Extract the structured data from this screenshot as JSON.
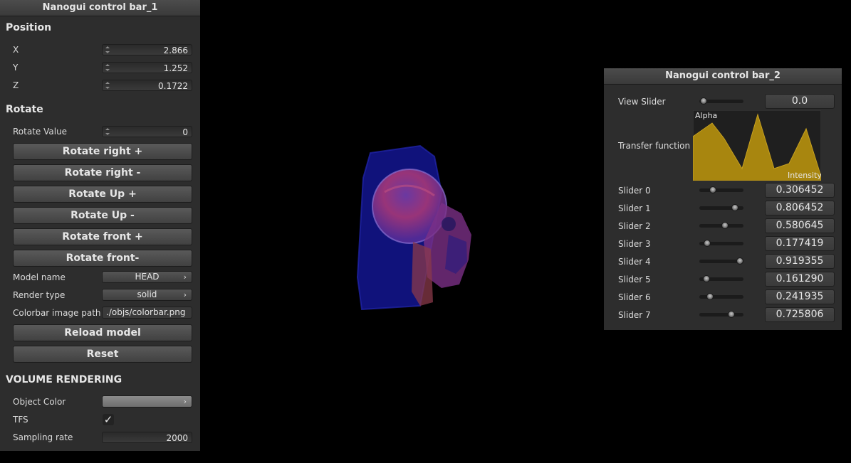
{
  "panel1": {
    "title": "Nanogui control bar_1",
    "position_header": "Position",
    "x_label": "X",
    "x_value": "2.866",
    "y_label": "Y",
    "y_value": "1.252",
    "z_label": "Z",
    "z_value": "0.1722",
    "rotate_header": "Rotate",
    "rotate_value_label": "Rotate Value",
    "rotate_value": "0",
    "buttons": [
      "Rotate right +",
      "Rotate right -",
      "Rotate Up +",
      "Rotate Up -",
      "Rotate front +",
      "Rotate front-"
    ],
    "model_name_label": "Model name",
    "model_name_value": "HEAD",
    "render_type_label": "Render type",
    "render_type_value": "solid",
    "colorbar_label": "Colorbar image path",
    "colorbar_value": "./objs/colorbar.png",
    "reload_label": "Reload model",
    "reset_label": "Reset",
    "volume_header": "VOLUME RENDERING",
    "object_color_label": "Object Color",
    "tfs_label": "TFS",
    "tfs_checked": true,
    "sampling_label": "Sampling rate",
    "sampling_value": "2000"
  },
  "panel2": {
    "title": "Nanogui control bar_2",
    "view_slider_label": "View Slider",
    "view_slider_value": "0.0",
    "transfer_label": "Transfer function",
    "tf_alpha_label": "Alpha",
    "tf_intensity_label": "Intensity",
    "tf_fill_color": "#a8860f",
    "sliders": [
      {
        "label": "Slider 0",
        "value": "0.306452",
        "level": 0.306452
      },
      {
        "label": "Slider 1",
        "value": "0.806452",
        "level": 0.806452
      },
      {
        "label": "Slider 2",
        "value": "0.580645",
        "level": 0.580645
      },
      {
        "label": "Slider 3",
        "value": "0.177419",
        "level": 0.177419
      },
      {
        "label": "Slider 4",
        "value": "0.919355",
        "level": 0.919355
      },
      {
        "label": "Slider 5",
        "value": "0.161290",
        "level": 0.16129
      },
      {
        "label": "Slider 6",
        "value": "0.241935",
        "level": 0.241935
      },
      {
        "label": "Slider 7",
        "value": "0.725806",
        "level": 0.725806
      }
    ]
  },
  "viewport": {
    "subject": "skull-volume-render",
    "icon": "check-icon",
    "chevron": "chevron-right-icon"
  }
}
